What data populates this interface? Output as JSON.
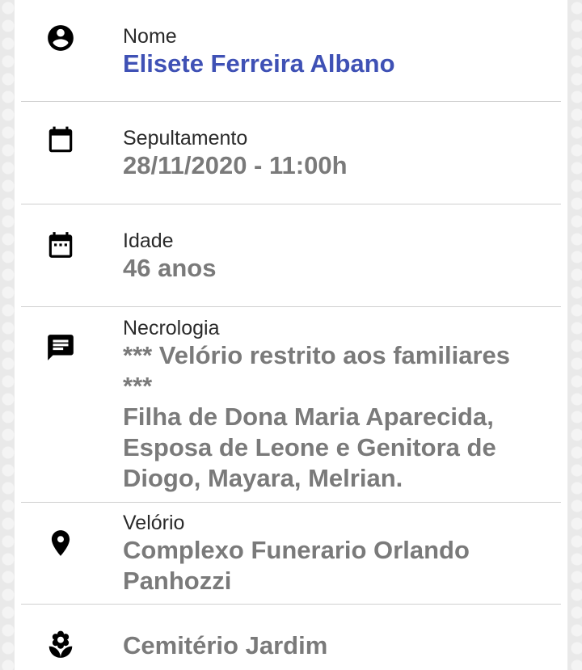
{
  "rows": {
    "nome": {
      "label": "Nome",
      "value": "Elisete Ferreira Albano",
      "icon": "account-circle-icon"
    },
    "sepultamento": {
      "label": "Sepultamento",
      "value": "28/11/2020 - 11:00h",
      "icon": "calendar-icon"
    },
    "idade": {
      "label": "Idade",
      "value": "46 anos",
      "icon": "calendar-dots-icon"
    },
    "necrologia": {
      "label": "Necrologia",
      "lines": [
        "*** Velório restrito aos familiares ***",
        "Filha de Dona Maria Aparecida, Esposa de Leone e Genitora de Diogo, Mayara, Melrian."
      ],
      "icon": "message-icon"
    },
    "velorio": {
      "label": "Velório",
      "value": "Complexo Funerario Orlando Panhozzi",
      "icon": "location-pin-icon"
    },
    "cemiterio": {
      "value": "Cemitério Jardim",
      "icon": "flower-icon"
    }
  },
  "colors": {
    "name": "#3f51b5",
    "value": "#7a7a7a",
    "label": "#2a2a2a",
    "divider": "#cfcfcf"
  }
}
